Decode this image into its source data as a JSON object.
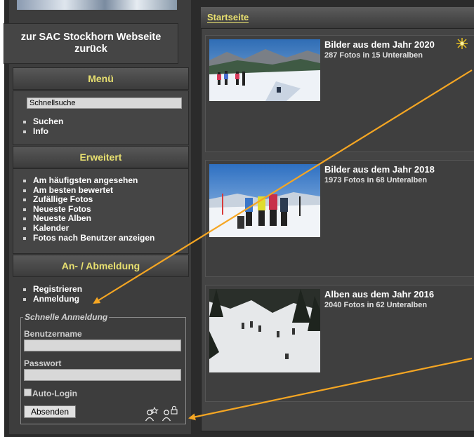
{
  "sidebar": {
    "back_link": "zur SAC Stockhorn Webseite zurück",
    "menu_heading": "Menü",
    "search_placeholder": "Schnellsuche",
    "menu_items": [
      "Suchen",
      "Info"
    ],
    "extended_heading": "Erweitert",
    "extended_items": [
      "Am häufigsten angesehen",
      "Am besten bewertet",
      "Zufällige Fotos",
      "Neueste Fotos",
      "Neueste Alben",
      "Kalender",
      "Fotos nach Benutzer anzeigen"
    ],
    "login_heading": "An- / Abmeldung",
    "login_items": [
      "Registrieren",
      "Anmeldung"
    ],
    "quick_login": {
      "legend": "Schnelle Anmeldung",
      "username_label": "Benutzername",
      "password_label": "Passwort",
      "autologin_label": "Auto-Login",
      "submit_label": "Absenden"
    }
  },
  "main": {
    "breadcrumb": "Startseite",
    "albums": [
      {
        "title": "Bilder aus dem Jahr 2020",
        "info": "287 Fotos in 15 Unteralben"
      },
      {
        "title": "Bilder aus dem Jahr 2018",
        "info": "1973 Fotos in 68 Unteralben"
      },
      {
        "title": "Alben aus dem Jahr 2016",
        "info": "2040 Fotos in 62 Unteralben"
      }
    ]
  },
  "icons": {
    "new_icon": "sparkle-icon",
    "register_icon": "user-star-icon",
    "login_icon": "user-lock-icon"
  },
  "colors": {
    "accent": "#e8e070",
    "arrow": "#f5a623",
    "background": "#3d3d3d"
  }
}
